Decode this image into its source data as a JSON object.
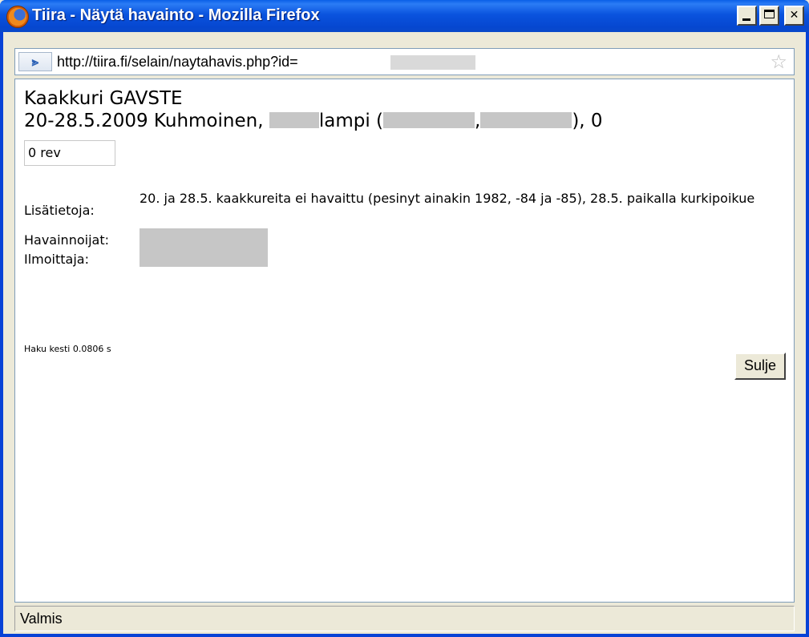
{
  "window": {
    "title": "Tiira - Näytä havainto - Mozilla Firefox",
    "icon": "firefox-icon",
    "minimize_glyph": "_",
    "maximize_glyph": "□",
    "close_glyph": "✕"
  },
  "urlbar": {
    "url": "http://tiira.fi/selain/naytahavis.php?id=",
    "site_icon_glyph": "⪢",
    "bookmark_icon": "☆"
  },
  "observation": {
    "species": "Kaakkuri GAVSTE",
    "date_place_prefix": "20-28.5.2009 Kuhmoinen, ",
    "lake_suffix": "lampi (",
    "coord_separator": ",",
    "coords_end": "), 0",
    "count": "0  rev",
    "notes_label": "Lisätietoja:",
    "notes": "20. ja 28.5. kaakkureita ei havaittu (pesinyt ainakin 1982, -84 ja -85), 28.5. paikalla kurkipoikue",
    "observers_label": "Havainnoijat:",
    "reporter_label": "Ilmoittaja:",
    "timing": "Haku kesti 0.0806 s",
    "close_label": "Sulje"
  },
  "status": {
    "text": "Valmis"
  }
}
